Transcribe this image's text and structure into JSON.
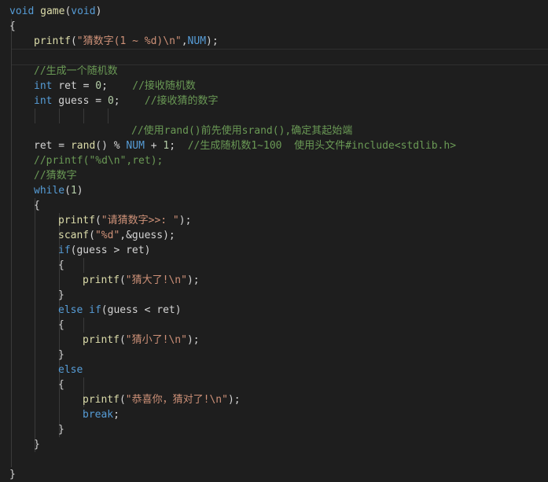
{
  "editor": {
    "lines": [
      {
        "indent": 0,
        "tokens": [
          {
            "t": "kw",
            "v": "void"
          },
          {
            "t": "p",
            "v": " "
          },
          {
            "t": "fn",
            "v": "game"
          },
          {
            "t": "p",
            "v": "("
          },
          {
            "t": "kw",
            "v": "void"
          },
          {
            "t": "p",
            "v": ")"
          }
        ]
      },
      {
        "indent": 0,
        "tokens": [
          {
            "t": "p",
            "v": "{"
          }
        ]
      },
      {
        "indent": 1,
        "tokens": [
          {
            "t": "fn",
            "v": "printf"
          },
          {
            "t": "p",
            "v": "("
          },
          {
            "t": "str",
            "v": "\"猜数字(1 ~ %d)\\n\""
          },
          {
            "t": "p",
            "v": ","
          },
          {
            "t": "mac",
            "v": "NUM"
          },
          {
            "t": "p",
            "v": ");"
          }
        ]
      },
      {
        "indent": 0,
        "tokens": []
      },
      {
        "indent": 1,
        "tokens": [
          {
            "t": "cm",
            "v": "//生成一个随机数"
          }
        ]
      },
      {
        "indent": 1,
        "tokens": [
          {
            "t": "kw",
            "v": "int"
          },
          {
            "t": "p",
            "v": " ret = "
          },
          {
            "t": "num",
            "v": "0"
          },
          {
            "t": "p",
            "v": ";    "
          },
          {
            "t": "cm",
            "v": "//接收随机数"
          }
        ]
      },
      {
        "indent": 1,
        "tokens": [
          {
            "t": "kw",
            "v": "int"
          },
          {
            "t": "p",
            "v": " guess = "
          },
          {
            "t": "num",
            "v": "0"
          },
          {
            "t": "p",
            "v": ";    "
          },
          {
            "t": "cm",
            "v": "//接收猜的数字"
          }
        ]
      },
      {
        "indent": 0,
        "tokens": []
      },
      {
        "indent": 5,
        "tokens": [
          {
            "t": "cm",
            "v": "//使用rand()前先使用srand(),确定其起始端"
          }
        ]
      },
      {
        "indent": 1,
        "tokens": [
          {
            "t": "p",
            "v": "ret = "
          },
          {
            "t": "fn",
            "v": "rand"
          },
          {
            "t": "p",
            "v": "() % "
          },
          {
            "t": "mac",
            "v": "NUM"
          },
          {
            "t": "p",
            "v": " + "
          },
          {
            "t": "num",
            "v": "1"
          },
          {
            "t": "p",
            "v": ";  "
          },
          {
            "t": "cm",
            "v": "//生成随机数1~100  使用头文件#include<stdlib.h>"
          }
        ]
      },
      {
        "indent": 1,
        "tokens": [
          {
            "t": "cm",
            "v": "//printf(\"%d\\n\",ret);"
          }
        ]
      },
      {
        "indent": 1,
        "tokens": [
          {
            "t": "cm",
            "v": "//猜数字"
          }
        ]
      },
      {
        "indent": 1,
        "tokens": [
          {
            "t": "kw",
            "v": "while"
          },
          {
            "t": "p",
            "v": "("
          },
          {
            "t": "num",
            "v": "1"
          },
          {
            "t": "p",
            "v": ")"
          }
        ]
      },
      {
        "indent": 1,
        "tokens": [
          {
            "t": "p",
            "v": "{"
          }
        ]
      },
      {
        "indent": 2,
        "tokens": [
          {
            "t": "fn",
            "v": "printf"
          },
          {
            "t": "p",
            "v": "("
          },
          {
            "t": "str",
            "v": "\"请猜数字>>: \""
          },
          {
            "t": "p",
            "v": ");"
          }
        ]
      },
      {
        "indent": 2,
        "tokens": [
          {
            "t": "fn",
            "v": "scanf"
          },
          {
            "t": "p",
            "v": "("
          },
          {
            "t": "str",
            "v": "\"%d\""
          },
          {
            "t": "p",
            "v": ",&guess);"
          }
        ]
      },
      {
        "indent": 2,
        "tokens": [
          {
            "t": "kw",
            "v": "if"
          },
          {
            "t": "p",
            "v": "(guess > ret)"
          }
        ]
      },
      {
        "indent": 2,
        "tokens": [
          {
            "t": "p",
            "v": "{"
          }
        ]
      },
      {
        "indent": 3,
        "tokens": [
          {
            "t": "fn",
            "v": "printf"
          },
          {
            "t": "p",
            "v": "("
          },
          {
            "t": "str",
            "v": "\"猜大了!\\n\""
          },
          {
            "t": "p",
            "v": ");"
          }
        ]
      },
      {
        "indent": 2,
        "tokens": [
          {
            "t": "p",
            "v": "}"
          }
        ]
      },
      {
        "indent": 2,
        "tokens": [
          {
            "t": "kw",
            "v": "else"
          },
          {
            "t": "p",
            "v": " "
          },
          {
            "t": "kw",
            "v": "if"
          },
          {
            "t": "p",
            "v": "(guess < ret)"
          }
        ]
      },
      {
        "indent": 2,
        "tokens": [
          {
            "t": "p",
            "v": "{"
          }
        ]
      },
      {
        "indent": 3,
        "tokens": [
          {
            "t": "fn",
            "v": "printf"
          },
          {
            "t": "p",
            "v": "("
          },
          {
            "t": "str",
            "v": "\"猜小了!\\n\""
          },
          {
            "t": "p",
            "v": ");"
          }
        ]
      },
      {
        "indent": 2,
        "tokens": [
          {
            "t": "p",
            "v": "}"
          }
        ]
      },
      {
        "indent": 2,
        "tokens": [
          {
            "t": "kw",
            "v": "else"
          }
        ]
      },
      {
        "indent": 2,
        "tokens": [
          {
            "t": "p",
            "v": "{"
          }
        ]
      },
      {
        "indent": 3,
        "tokens": [
          {
            "t": "fn",
            "v": "printf"
          },
          {
            "t": "p",
            "v": "("
          },
          {
            "t": "str",
            "v": "\"恭喜你，猜对了!\\n\""
          },
          {
            "t": "p",
            "v": ");"
          }
        ]
      },
      {
        "indent": 3,
        "tokens": [
          {
            "t": "kw",
            "v": "break"
          },
          {
            "t": "p",
            "v": ";"
          }
        ]
      },
      {
        "indent": 2,
        "tokens": [
          {
            "t": "p",
            "v": "}"
          }
        ]
      },
      {
        "indent": 1,
        "tokens": [
          {
            "t": "p",
            "v": "}"
          }
        ]
      },
      {
        "indent": 0,
        "tokens": []
      },
      {
        "indent": 0,
        "tokens": [
          {
            "t": "p",
            "v": "}"
          }
        ]
      }
    ]
  },
  "colors": {
    "background": "#1e1e1e",
    "keyword": "#569cd6",
    "function": "#dcdcaa",
    "string": "#ce9178",
    "comment": "#6a9955",
    "number": "#b5cea8",
    "text": "#d4d4d4"
  }
}
